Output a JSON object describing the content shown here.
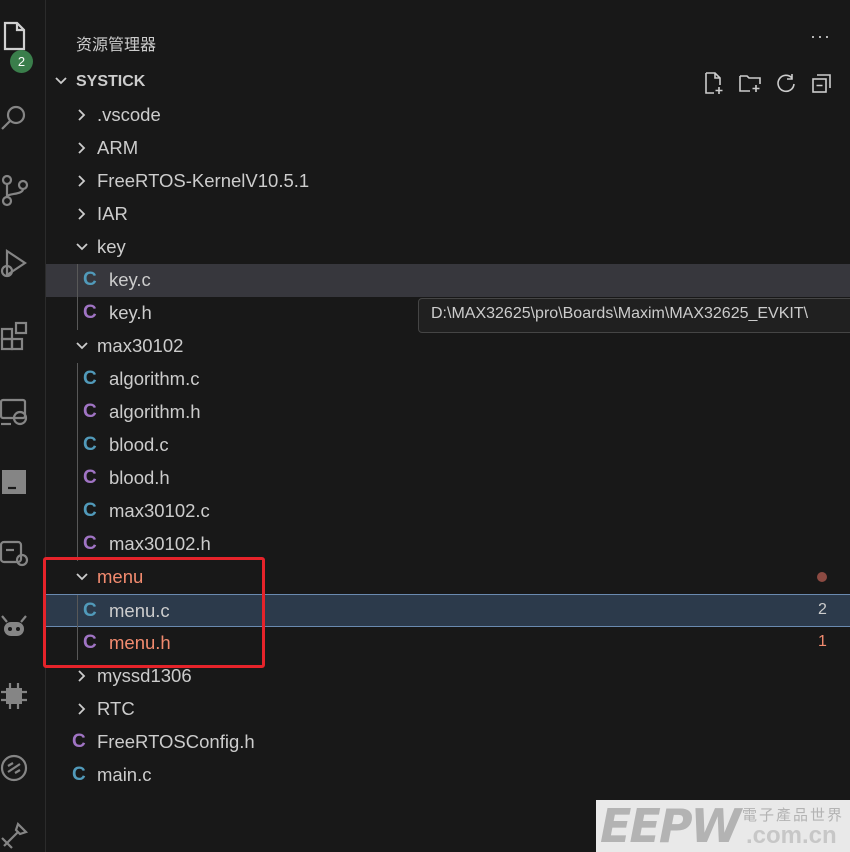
{
  "activity_bar": {
    "icons": [
      "explorer-icon",
      "search-icon",
      "source-control-icon",
      "run-debug-icon",
      "extensions-icon",
      "remote-explorer-icon",
      "terminal-icon",
      "device-settings-icon",
      "robot-icon",
      "chip-icon",
      "link-icon",
      "tools-icon"
    ],
    "explorer_badge": "2"
  },
  "sidebar": {
    "title": "资源管理器",
    "more_label": "···",
    "section": {
      "title": "SYSTICK",
      "actions": [
        "new-file-icon",
        "new-folder-icon",
        "refresh-icon",
        "collapse-all-icon"
      ]
    },
    "tree": [
      {
        "type": "folder",
        "label": ".vscode",
        "expanded": false
      },
      {
        "type": "folder",
        "label": "ARM",
        "expanded": false
      },
      {
        "type": "folder",
        "label": "FreeRTOS-KernelV10.5.1",
        "expanded": false
      },
      {
        "type": "folder",
        "label": "IAR",
        "expanded": false
      },
      {
        "type": "folder",
        "label": "key",
        "expanded": true
      },
      {
        "type": "file",
        "icon": "C",
        "kind": "c",
        "label": "key.c",
        "selected": true
      },
      {
        "type": "file",
        "icon": "C",
        "kind": "h",
        "label": "key.h"
      },
      {
        "type": "folder",
        "label": "max30102",
        "expanded": true
      },
      {
        "type": "file",
        "icon": "C",
        "kind": "c",
        "label": "algorithm.c"
      },
      {
        "type": "file",
        "icon": "C",
        "kind": "h",
        "label": "algorithm.h"
      },
      {
        "type": "file",
        "icon": "C",
        "kind": "c",
        "label": "blood.c"
      },
      {
        "type": "file",
        "icon": "C",
        "kind": "h",
        "label": "blood.h"
      },
      {
        "type": "file",
        "icon": "C",
        "kind": "c",
        "label": "max30102.c"
      },
      {
        "type": "file",
        "icon": "C",
        "kind": "h",
        "label": "max30102.h"
      },
      {
        "type": "folder",
        "label": "menu",
        "expanded": true,
        "error": true
      },
      {
        "type": "file",
        "icon": "C",
        "kind": "c",
        "label": "menu.c",
        "count": "2",
        "focused": true
      },
      {
        "type": "file",
        "icon": "C",
        "kind": "h",
        "label": "menu.h",
        "count": "1",
        "error": true
      },
      {
        "type": "folder",
        "label": "myssd1306",
        "expanded": false
      },
      {
        "type": "folder",
        "label": "RTC",
        "expanded": false
      },
      {
        "type": "file",
        "icon": "C",
        "kind": "h",
        "label": "FreeRTOSConfig.h"
      },
      {
        "type": "file",
        "icon": "C",
        "kind": "c",
        "label": "main.c"
      }
    ]
  },
  "tooltip": {
    "text": "D:\\MAX32625\\pro\\Boards\\Maxim\\MAX32625_EVKIT\\"
  },
  "watermark": {
    "brand": "EEPW",
    "chinese": "電子產品世界",
    "domain": ".com.cn"
  },
  "colors": {
    "accent_error": "#f28b6f",
    "c_file": "#519aba",
    "h_file": "#a074c4",
    "annotation": "#e5232a",
    "badge": "#3a7e4b"
  }
}
